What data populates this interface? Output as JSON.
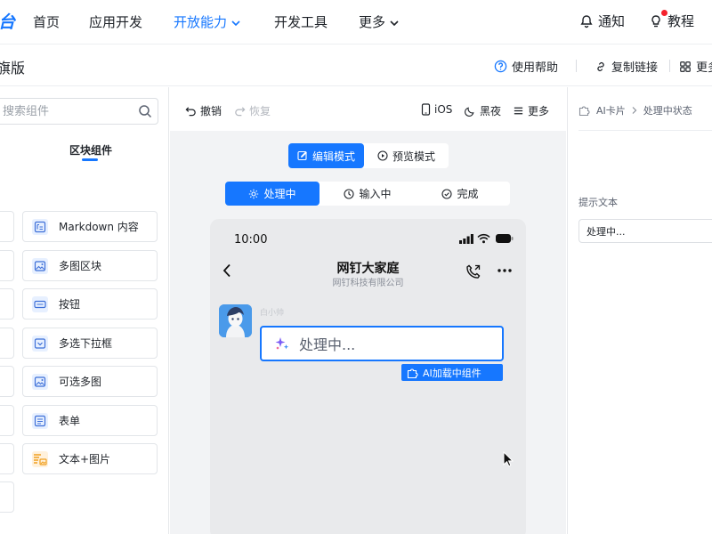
{
  "nav": {
    "brand_fragment": "台",
    "items": [
      {
        "label": "首页"
      },
      {
        "label": "应用开发"
      },
      {
        "label": "开放能力"
      },
      {
        "label": "开发工具"
      },
      {
        "label": "更多"
      }
    ],
    "notify_label": "通知",
    "tutorial_label": "教程",
    "accent": "#1677ff"
  },
  "subheader": {
    "title": "旗版",
    "help_label": "使用帮助",
    "copy_link_label": "复制链接",
    "more_label": "更多"
  },
  "left": {
    "search_placeholder": "搜索组件",
    "tab_label": "区块组件",
    "components": [
      {
        "label": "Markdown 内容",
        "icon": "markdown-icon"
      },
      {
        "label": "多图区块",
        "icon": "image-icon"
      },
      {
        "label": "按钮",
        "icon": "button-icon"
      },
      {
        "label": "多选下拉框",
        "icon": "dropdown-icon"
      },
      {
        "label": "可选多图",
        "icon": "image-icon"
      },
      {
        "label": "表单",
        "icon": "form-icon"
      },
      {
        "label": "文本+图片",
        "icon": "text-image-icon"
      }
    ]
  },
  "center": {
    "undo_label": "撤销",
    "redo_label": "恢复",
    "ios_label": "iOS",
    "dark_label": "黑夜",
    "more_label": "更多",
    "modes": [
      {
        "label": "编辑模式"
      },
      {
        "label": "预览模式"
      }
    ],
    "states": [
      {
        "label": "处理中"
      },
      {
        "label": "输入中"
      },
      {
        "label": "完成"
      }
    ],
    "phone": {
      "time": "10:00",
      "chat_title": "网钉大家庭",
      "chat_subtitle": "网钉科技有限公司",
      "sender": "白小帅",
      "message": "处理中...",
      "ai_tag": "AI加载中组件"
    }
  },
  "right": {
    "breadcrumb_root": "AI卡片",
    "breadcrumb_current": "处理中状态",
    "field_label": "提示文本",
    "field_value": "处理中..."
  }
}
